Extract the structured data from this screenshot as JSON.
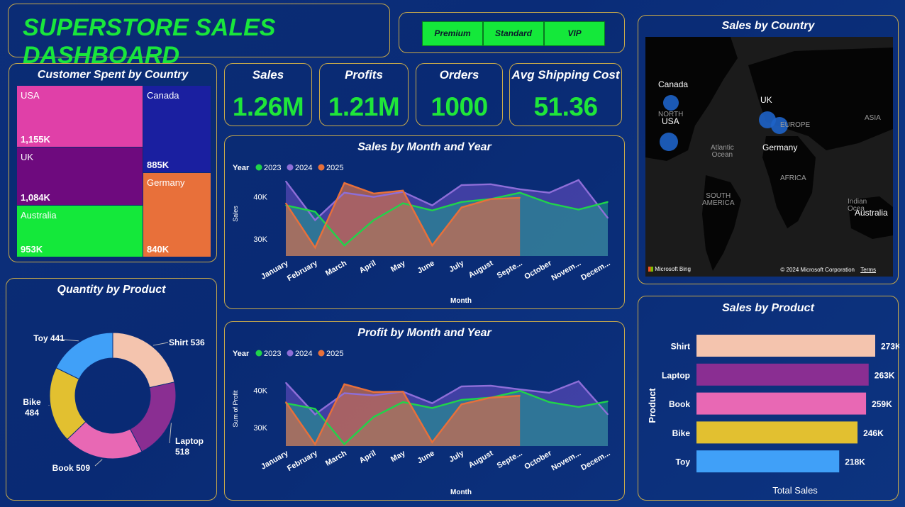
{
  "header": {
    "title": "SUPERSTORE SALES DASHBOARD",
    "slicer": [
      "Premium",
      "Standard",
      "VIP"
    ]
  },
  "kpis": [
    {
      "label": "Sales",
      "value": "1.26M"
    },
    {
      "label": "Profits",
      "value": "1.21M"
    },
    {
      "label": "Orders",
      "value": "1000"
    },
    {
      "label": "Avg Shipping Cost",
      "value": "51.36"
    }
  ],
  "treemap": {
    "title": "Customer Spent by Country",
    "cells": [
      {
        "name": "USA",
        "value": "1,155K",
        "color": "#e040a8"
      },
      {
        "name": "UK",
        "value": "1,084K",
        "color": "#6e0a7e"
      },
      {
        "name": "Australia",
        "value": "953K",
        "color": "#14e83a"
      },
      {
        "name": "Canada",
        "value": "885K",
        "color": "#1a1fa0"
      },
      {
        "name": "Germany",
        "value": "840K",
        "color": "#e8703a"
      }
    ]
  },
  "map": {
    "title": "Sales by Country",
    "labels": [
      "Canada",
      "USA",
      "UK",
      "Germany",
      "Australia"
    ],
    "faint_labels": {
      "north": "NORTH",
      "atlantic": "Atlantic\nOcean",
      "europe": "EUROPE",
      "asia": "ASIA",
      "africa": "AFRICA",
      "south_america": "SOUTH\nAMERICA",
      "indian": "Indian\nOcea"
    },
    "brand": "Microsoft Bing",
    "copyright": "© 2024 Microsoft Corporation",
    "terms": "Terms"
  },
  "chart_data": [
    {
      "id": "sales_month",
      "type": "area",
      "title": "Sales by Month and Year",
      "legend_title": "Year",
      "xlabel": "Month",
      "ylabel": "Sales",
      "categories": [
        "January",
        "February",
        "March",
        "April",
        "May",
        "June",
        "July",
        "August",
        "Septe...",
        "October",
        "Novem...",
        "Decem..."
      ],
      "yticks": [
        "30K",
        "40K"
      ],
      "ylim": [
        26000,
        46000
      ],
      "series": [
        {
          "name": "2023",
          "color": "#20d44a",
          "values": [
            38000,
            36500,
            28500,
            34500,
            38500,
            36800,
            38800,
            39500,
            41000,
            38500,
            37000,
            38800
          ]
        },
        {
          "name": "2024",
          "color": "#8e6ed8",
          "values": [
            43700,
            34500,
            41000,
            40000,
            41200,
            38000,
            42800,
            43000,
            41800,
            41000,
            44000,
            35000
          ]
        },
        {
          "name": "2025",
          "color": "#e8703a",
          "values": [
            38500,
            28000,
            43300,
            40800,
            41500,
            28500,
            37500,
            39500,
            39800
          ]
        }
      ]
    },
    {
      "id": "profit_month",
      "type": "area",
      "title": "Profit by Month and Year",
      "legend_title": "Year",
      "xlabel": "Month",
      "ylabel": "Sum of Profit",
      "categories": [
        "January",
        "February",
        "March",
        "April",
        "May",
        "June",
        "July",
        "August",
        "Septe...",
        "October",
        "Novem...",
        "Decem..."
      ],
      "yticks": [
        "30K",
        "40K"
      ],
      "ylim": [
        25000,
        45000
      ],
      "series": [
        {
          "name": "2023",
          "color": "#20d44a",
          "values": [
            36500,
            35000,
            25500,
            32800,
            36800,
            35200,
            37400,
            38000,
            39800,
            36800,
            35500,
            37000
          ]
        },
        {
          "name": "2024",
          "color": "#8e6ed8",
          "values": [
            42000,
            33500,
            39200,
            38600,
            39600,
            36500,
            41000,
            41200,
            40200,
            39300,
            42400,
            33500
          ]
        },
        {
          "name": "2025",
          "color": "#e8703a",
          "values": [
            36800,
            25500,
            41600,
            39500,
            39600,
            26000,
            36200,
            38000,
            38500
          ]
        }
      ]
    },
    {
      "id": "quantity_product",
      "type": "pie",
      "title": "Quantity by Product",
      "categories": [
        "Shirt",
        "Laptop",
        "Book",
        "Bike",
        "Toy"
      ],
      "values": [
        536,
        518,
        509,
        484,
        441
      ],
      "colors": [
        "#f4c4ae",
        "#8a2e92",
        "#e868b4",
        "#e2c030",
        "#40a0f8"
      ],
      "labels": [
        [
          "Shirt 536"
        ],
        [
          "Laptop",
          "518"
        ],
        [
          "Book 509"
        ],
        [
          "Bike",
          "484"
        ],
        [
          "Toy 441"
        ]
      ]
    },
    {
      "id": "sales_product",
      "type": "bar",
      "title": "Sales by Product",
      "xlabel": "Total Sales",
      "ylabel": "Product",
      "categories": [
        "Shirt",
        "Laptop",
        "Book",
        "Bike",
        "Toy"
      ],
      "values": [
        273000,
        263000,
        259000,
        246000,
        218000
      ],
      "value_labels": [
        "273K",
        "263K",
        "259K",
        "246K",
        "218K"
      ],
      "colors": [
        "#f4c4ae",
        "#8a2e92",
        "#e868b4",
        "#e2c030",
        "#40a0f8"
      ]
    }
  ]
}
